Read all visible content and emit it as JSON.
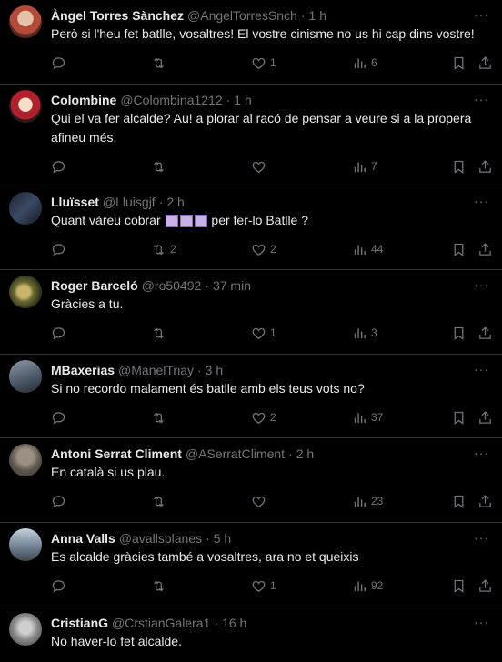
{
  "tweets": [
    {
      "name": "Àngel Torres Sànchez",
      "handle": "@AngelTorresSnch",
      "time": "1 h",
      "text": "Però si l'heu fet batlle, vosaltres! El vostre cinisme no us hi cap dins vostre!",
      "retweets": "",
      "likes": "1",
      "views": "6",
      "avatar_color": "#b34a3a"
    },
    {
      "name": "Colombine",
      "handle": "@Colombina1212",
      "time": "1 h",
      "text": "Qui el va fer alcalde? Au! a plorar al racó de pensar a veure si a la propera afineu més.",
      "retweets": "",
      "likes": "",
      "views": "7",
      "avatar_color": "#b21f2d"
    },
    {
      "name": "Lluïsset",
      "handle": "@Lluisgjf",
      "time": "2 h",
      "text_before": "Quant vàreu cobrar ",
      "text_after": " per fer-lo Batlle ?",
      "retweets": "2",
      "likes": "2",
      "views": "44",
      "avatar_color": "#2c3140"
    },
    {
      "name": "Roger Barceló",
      "handle": "@ro50492",
      "time": "37 min",
      "text": "Gràcies a tu.",
      "retweets": "",
      "likes": "1",
      "views": "3",
      "avatar_color": "#6b6a33"
    },
    {
      "name": "MBaxerias",
      "handle": "@ManelTriay",
      "time": "3 h",
      "text": "Si no recordo malament és batlle amb els teus vots no?",
      "retweets": "",
      "likes": "2",
      "views": "37",
      "avatar_color": "#4e5a6a"
    },
    {
      "name": "Antoni Serrat Climent",
      "handle": "@ASerratCliment",
      "time": "2 h",
      "text": "En català si us plau.",
      "retweets": "",
      "likes": "",
      "views": "23",
      "avatar_color": "#5d564e"
    },
    {
      "name": "Anna Valls",
      "handle": "@avallsblanes",
      "time": "5 h",
      "text": "Es alcalde gràcies també a vosaltres, ara no et queixis",
      "retweets": "",
      "likes": "1",
      "views": "92",
      "avatar_color": "#7a8a9a"
    },
    {
      "name": "CristianG",
      "handle": "@CrstianGalera1",
      "time": "16 h",
      "text": "No haver-lo fet alcalde.",
      "avatar_color": "#888888"
    }
  ],
  "ui": {
    "separator": "·",
    "more": "···"
  },
  "colors": {
    "background": "#000000",
    "text": "#e7e9ea",
    "muted": "#71767b",
    "border": "#2f3336"
  }
}
